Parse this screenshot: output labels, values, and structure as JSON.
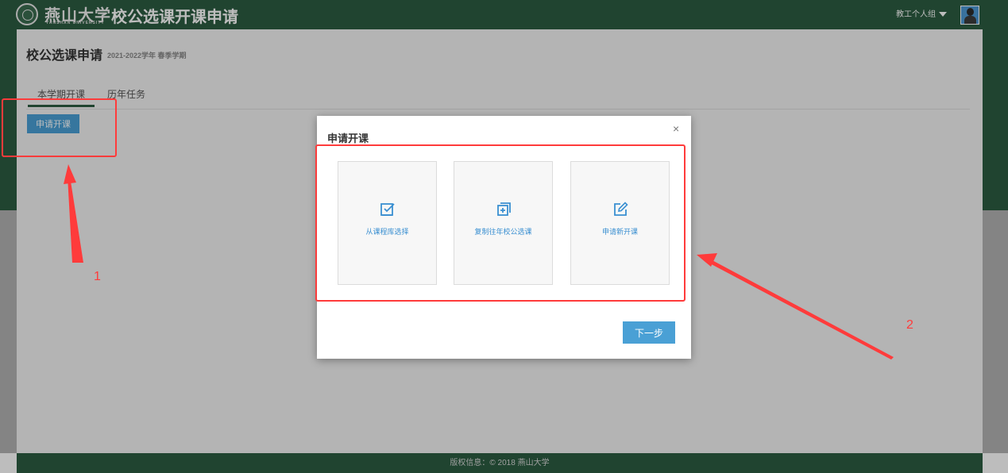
{
  "header": {
    "university_name": "燕山大学",
    "university_subtitle": "YANSHAN UNIVERSITY",
    "system_title": "校公选课开课申请",
    "user_menu_label": "教工个人组",
    "avatar_icon": "user-avatar"
  },
  "page": {
    "title": "校公选课申请",
    "subtitle": "2021-2022学年 春季学期"
  },
  "tabs": [
    {
      "label": "本学期开课",
      "active": true
    },
    {
      "label": "历年任务",
      "active": false
    }
  ],
  "actions": {
    "apply_label": "申请开课"
  },
  "modal": {
    "title": "申请开课",
    "close_symbol": "×",
    "options": [
      {
        "label": "从课程库选择",
        "icon": "checkbox-select-icon"
      },
      {
        "label": "复制往年校公选课",
        "icon": "copy-plus-icon"
      },
      {
        "label": "申请新开课",
        "icon": "edit-icon"
      }
    ],
    "next_label": "下一步"
  },
  "annotations": {
    "label_1": "1",
    "label_2": "2",
    "color": "#ff3b3b"
  },
  "footer": {
    "text": "版权信息：© 2018 燕山大学"
  },
  "colors": {
    "brand_green": "#2c5c41",
    "accent_blue": "#4aa0d5",
    "icon_blue": "#3a8fd1"
  }
}
